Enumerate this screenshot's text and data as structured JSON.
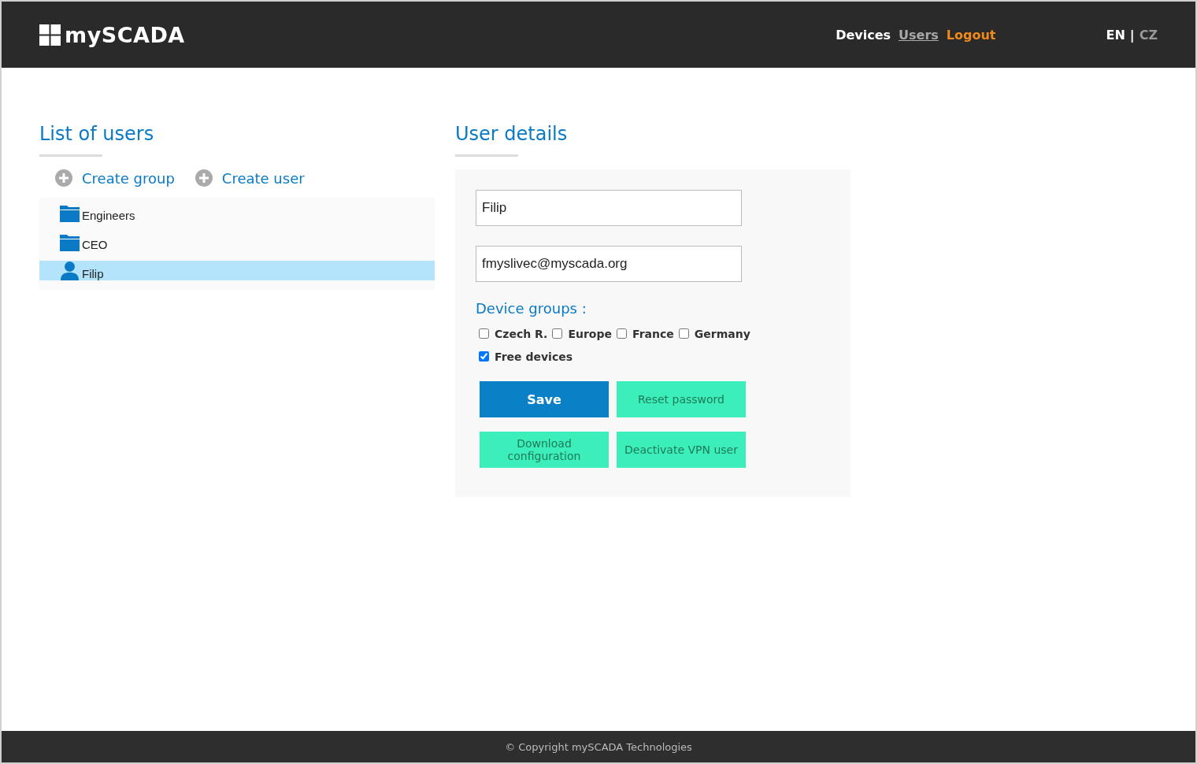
{
  "header": {
    "logo": "mySCADA",
    "nav": [
      {
        "label": "Devices",
        "kind": "plain",
        "selected": false
      },
      {
        "label": "Users",
        "kind": "plain",
        "selected": true
      },
      {
        "label": "Logout",
        "kind": "logout",
        "selected": false
      }
    ],
    "languages": [
      {
        "label": "EN",
        "selected": true
      },
      {
        "label": "CZ",
        "selected": false
      }
    ],
    "language_separator": "|"
  },
  "users_panel": {
    "title": "List of users",
    "actions": [
      "Create group",
      "Create user"
    ],
    "tree": [
      {
        "label": "Engineers",
        "kind": "folder",
        "selected": false
      },
      {
        "label": "CEO",
        "kind": "folder",
        "selected": false
      },
      {
        "label": "Filip",
        "kind": "user",
        "selected": true
      }
    ]
  },
  "details": {
    "title": "User details",
    "name": "Filip",
    "email": "fmyslivec@myscada.org",
    "groups_label": "Device groups :",
    "groups": [
      {
        "label": "Czech R.",
        "checked": false
      },
      {
        "label": "Europe",
        "checked": false
      },
      {
        "label": "France",
        "checked": false
      },
      {
        "label": "Germany",
        "checked": false
      },
      {
        "label": "Free devices",
        "checked": true
      }
    ],
    "buttons": [
      {
        "label": "Save",
        "kind": "primary"
      },
      {
        "label": "Reset password",
        "kind": "secondary"
      },
      {
        "label": "Download configuration",
        "kind": "secondary"
      },
      {
        "label": "Deactivate VPN user",
        "kind": "secondary"
      }
    ]
  },
  "footer": "© Copyright mySCADA Technologies"
}
